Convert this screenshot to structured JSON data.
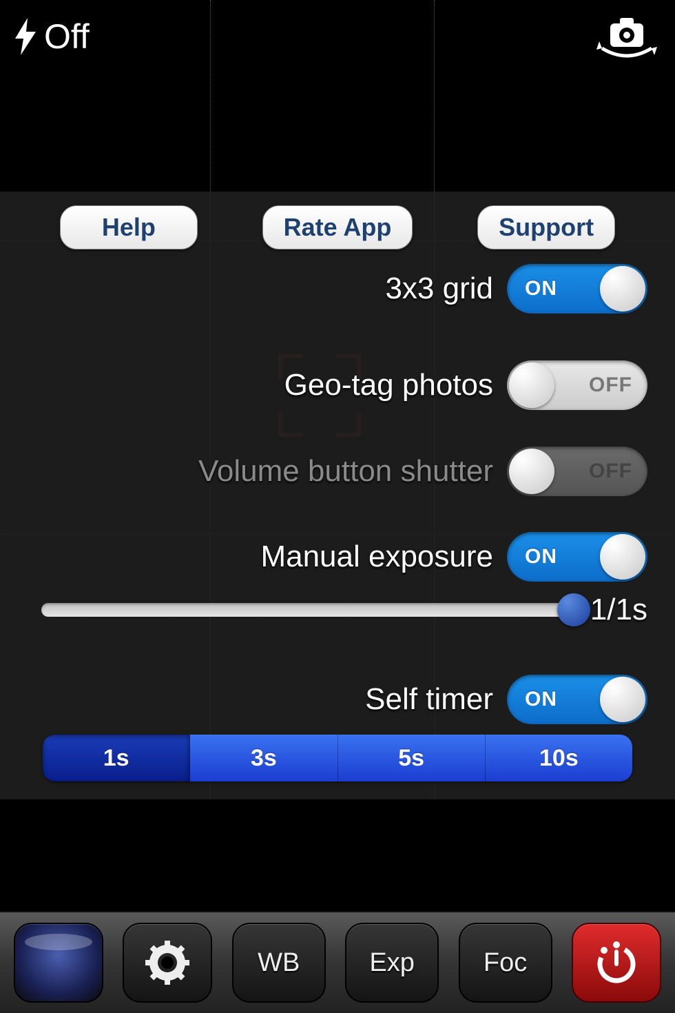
{
  "flash": {
    "label": "Off"
  },
  "buttons": {
    "help": "Help",
    "rate": "Rate App",
    "support": "Support"
  },
  "settings": {
    "grid": {
      "label": "3x3 grid",
      "state": "ON"
    },
    "geo": {
      "label": "Geo-tag photos",
      "state": "OFF"
    },
    "vol": {
      "label": "Volume button shutter",
      "state": "OFF"
    },
    "exp": {
      "label": "Manual exposure",
      "state": "ON"
    },
    "timer": {
      "label": "Self timer",
      "state": "ON"
    }
  },
  "exposure_value": "1/1s",
  "timer_options": {
    "a": "1s",
    "b": "3s",
    "c": "5s",
    "d": "10s"
  },
  "toolbar": {
    "wb": "WB",
    "exp": "Exp",
    "foc": "Foc"
  }
}
